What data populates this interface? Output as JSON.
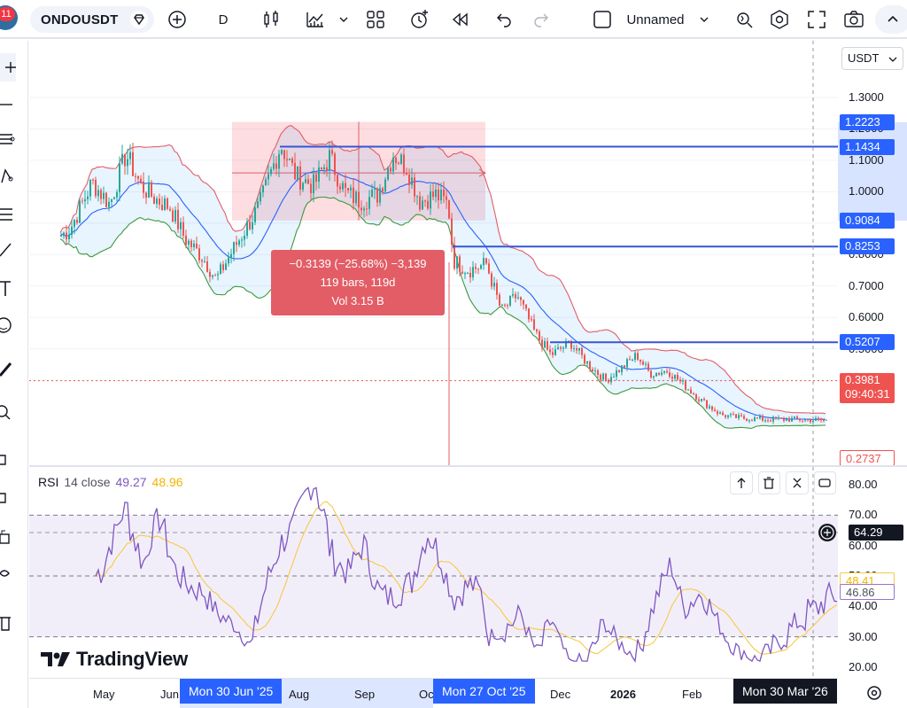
{
  "topbar": {
    "notification_count": "11",
    "symbol": "ONDOUSDT",
    "interval": "D",
    "layout_name": "Unnamed"
  },
  "scale": {
    "currency": "USDT",
    "price_ticks": [
      "1.3000",
      "1.2000",
      "1.1000",
      "1.0000",
      "0.9000",
      "0.8000",
      "0.7000",
      "0.6000",
      "0.5000",
      "0.4000"
    ],
    "price_labels": [
      {
        "value": "1.2223",
        "style": "blue"
      },
      {
        "value": "1.1434",
        "style": "blue"
      },
      {
        "value": "0.9084",
        "style": "blue"
      },
      {
        "value": "0.8253",
        "style": "blue"
      },
      {
        "value": "0.5207",
        "style": "blue"
      },
      {
        "value": "0.3981",
        "style": "red",
        "sub": "09:40:31"
      },
      {
        "value": "0.2737",
        "style": "outline-red"
      }
    ]
  },
  "measure": {
    "line1": "−0.3139 (−25.68%) −3,139",
    "line2": "119 bars, 119d",
    "line3": "Vol 3.15 B"
  },
  "horizontal_lines": [
    1.1434,
    0.8253,
    0.5207
  ],
  "rsi": {
    "title": "RSI",
    "params": "14 close",
    "rsi_value": "49.27",
    "ma_value": "48.96",
    "ticks": [
      "80.00",
      "70.00",
      "60.00",
      "50.00",
      "40.00",
      "30.00",
      "20.00"
    ],
    "labels": [
      {
        "value": "64.29",
        "style": "black"
      },
      {
        "value": "48.41",
        "style": "yellow"
      },
      {
        "value": "46.86",
        "style": "purple"
      }
    ],
    "rsi_color": "#7e57c2",
    "ma_color": "#f7c948"
  },
  "time_axis": {
    "ticks": [
      "May",
      "Jun",
      "Aug",
      "Sep",
      "Oc",
      "Dec",
      "2026",
      "Feb"
    ],
    "labels": [
      "Mon 30 Jun '25",
      "Mon 27 Oct '25",
      "Mon 30 Mar '26"
    ]
  },
  "branding": {
    "logo": "TradingView"
  },
  "colors": {
    "up": "#26a69a",
    "down": "#ef5350",
    "bb_upper": "#e35d66",
    "bb_lower": "#3d9a3d",
    "bb_basis": "#2962ff",
    "hline": "#3655d6",
    "label_blue": "#2962ff"
  }
}
